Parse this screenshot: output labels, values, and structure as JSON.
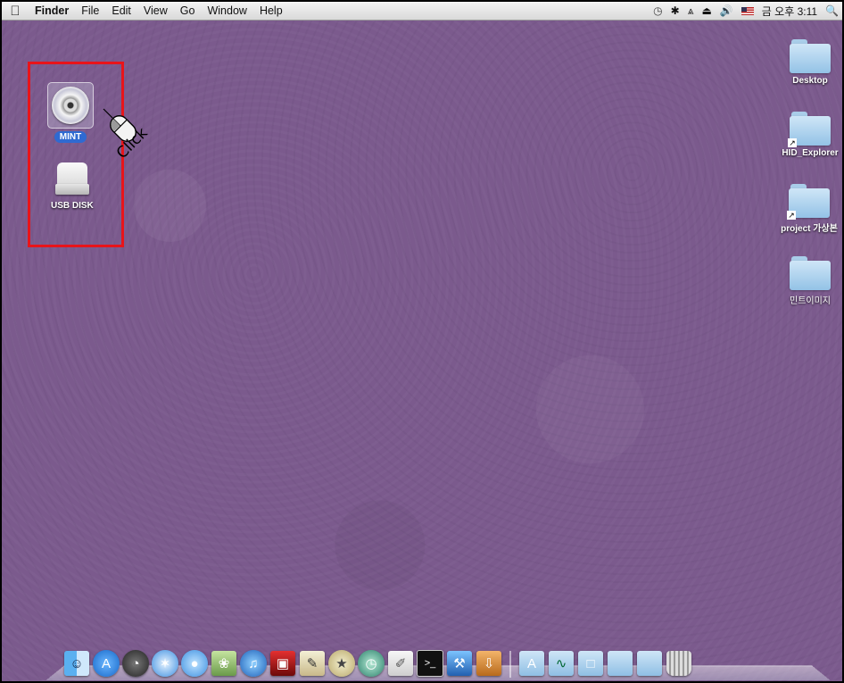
{
  "menubar": {
    "apple_icon": "apple-logo",
    "items": [
      "Finder",
      "File",
      "Edit",
      "View",
      "Go",
      "Window",
      "Help"
    ],
    "status": {
      "time_machine_icon": "time-machine-icon",
      "bluetooth_icon": "bluetooth-icon",
      "wifi_icon": "wifi-icon",
      "eject_icon": "eject-icon",
      "volume_icon": "volume-icon",
      "flag_icon": "us-flag-icon",
      "clock": "금 오후 3:11",
      "spotlight_icon": "spotlight-icon"
    }
  },
  "desktop_left": [
    {
      "label": "MINT",
      "icon": "cd-disc-icon",
      "selected": true
    },
    {
      "label": "USB DISK",
      "icon": "usb-disk-icon",
      "selected": false
    }
  ],
  "desktop_right": [
    {
      "label": "Desktop",
      "icon": "folder-icon",
      "alias": false
    },
    {
      "label": "HID_Explorer",
      "icon": "folder-icon",
      "alias": true
    },
    {
      "label": "project 가상본",
      "icon": "folder-icon",
      "alias": true
    },
    {
      "label": "민트이미지",
      "icon": "folder-icon",
      "alias": false
    }
  ],
  "annotation": {
    "text": "Click",
    "color": "#e8141a"
  },
  "dock": {
    "apps": [
      "finder-icon",
      "app-store-icon",
      "dashboard-icon",
      "safari-icon",
      "ichat-icon",
      "iphoto-icon",
      "itunes-icon",
      "photo-booth-icon",
      "textedit-icon",
      "imovie-icon",
      "time-machine-icon",
      "script-editor-icon",
      "terminal-icon",
      "xcode-icon",
      "installer-icon"
    ],
    "folders": [
      "applications-folder-icon",
      "activity-monitor-icon",
      "documents-folder-icon",
      "downloads-folder-icon",
      "stack-folder-icon",
      "trash-icon"
    ]
  },
  "colors": {
    "desktop": "#7b5a8d",
    "highlight": "#e8141a",
    "selected_label": "#2f6ad1"
  }
}
